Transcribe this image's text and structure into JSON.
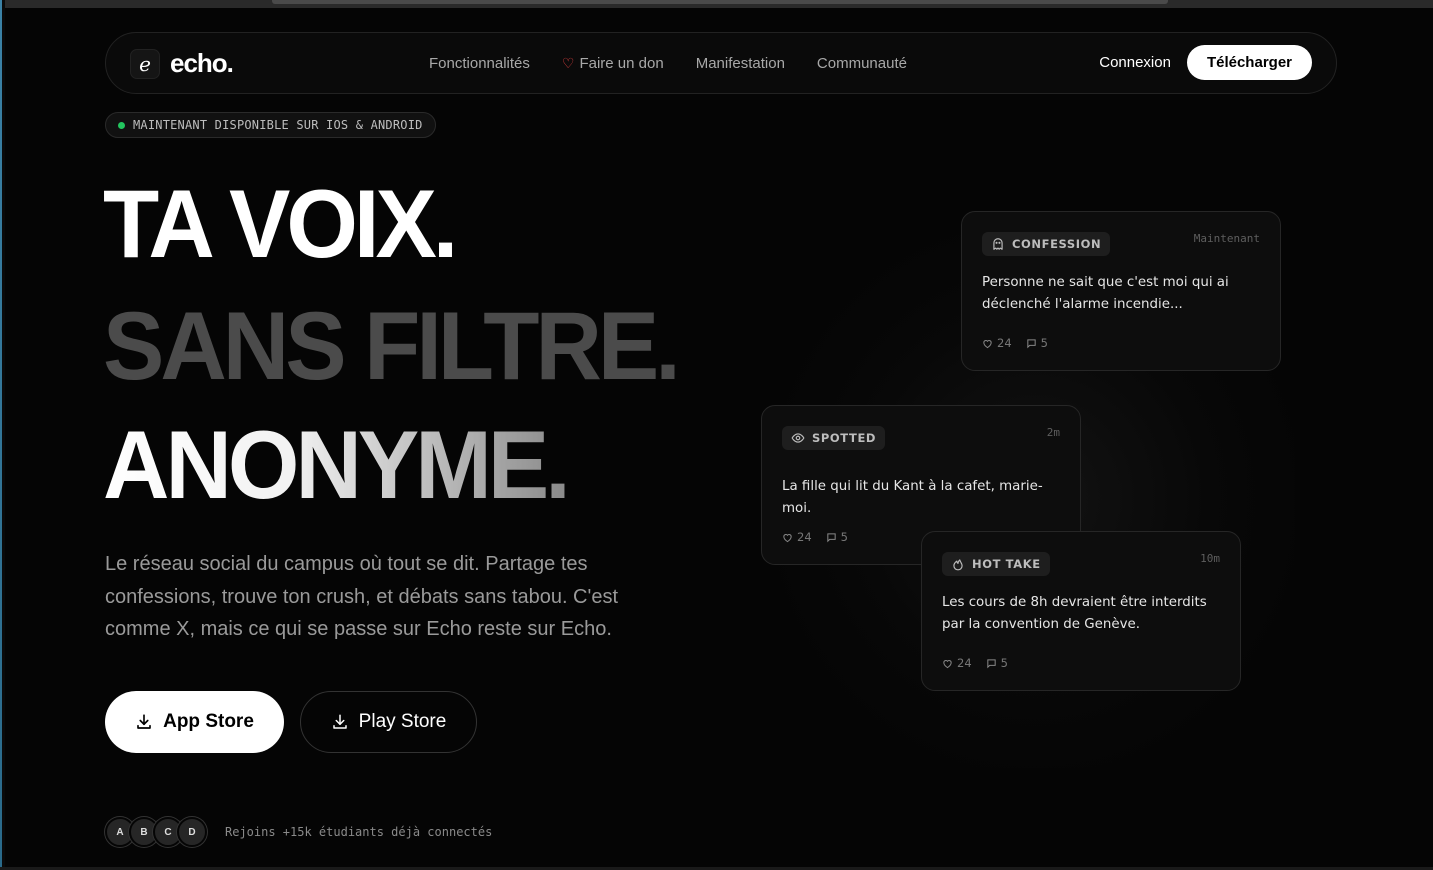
{
  "brand": {
    "logo_letter": "e",
    "name": "echo."
  },
  "nav": {
    "links": [
      "Fonctionnalités",
      "Faire un don",
      "Manifestation",
      "Communauté"
    ],
    "login": "Connexion",
    "download": "Télécharger"
  },
  "badge": {
    "text": "MAINTENANT DISPONIBLE SUR IOS & ANDROID"
  },
  "hero": {
    "line1": "TA VOIX.",
    "line2": "SANS FILTRE.",
    "line3": "ANONYME.",
    "description": "Le réseau social du campus où tout se dit. Partage tes confessions, trouve ton crush, et débats sans tabou. C'est comme X, mais ce qui se passe sur Echo reste sur Echo."
  },
  "buttons": {
    "app_store": "App Store",
    "play_store": "Play Store"
  },
  "social": {
    "avatars": [
      "A",
      "B",
      "C",
      "D"
    ],
    "text": "Rejoins +15k étudiants déjà connectés"
  },
  "cards": [
    {
      "tag": "CONFESSION",
      "icon": "ghost-icon",
      "time": "Maintenant",
      "text": "Personne ne sait que c'est moi qui ai déclenché l'alarme incendie...",
      "likes": "24",
      "comments": "5"
    },
    {
      "tag": "SPOTTED",
      "icon": "eye-icon",
      "time": "2m",
      "text": "La fille qui lit du Kant à la cafet, marie-moi.",
      "likes": "24",
      "comments": "5"
    },
    {
      "tag": "HOT TAKE",
      "icon": "flame-icon",
      "time": "10m",
      "text": "Les cours de 8h devraient être interdits par la convention de Genève.",
      "likes": "24",
      "comments": "5"
    }
  ],
  "colors": {
    "accent_green": "#22c55e",
    "heart_red": "#ef4444",
    "background": "#050505"
  }
}
